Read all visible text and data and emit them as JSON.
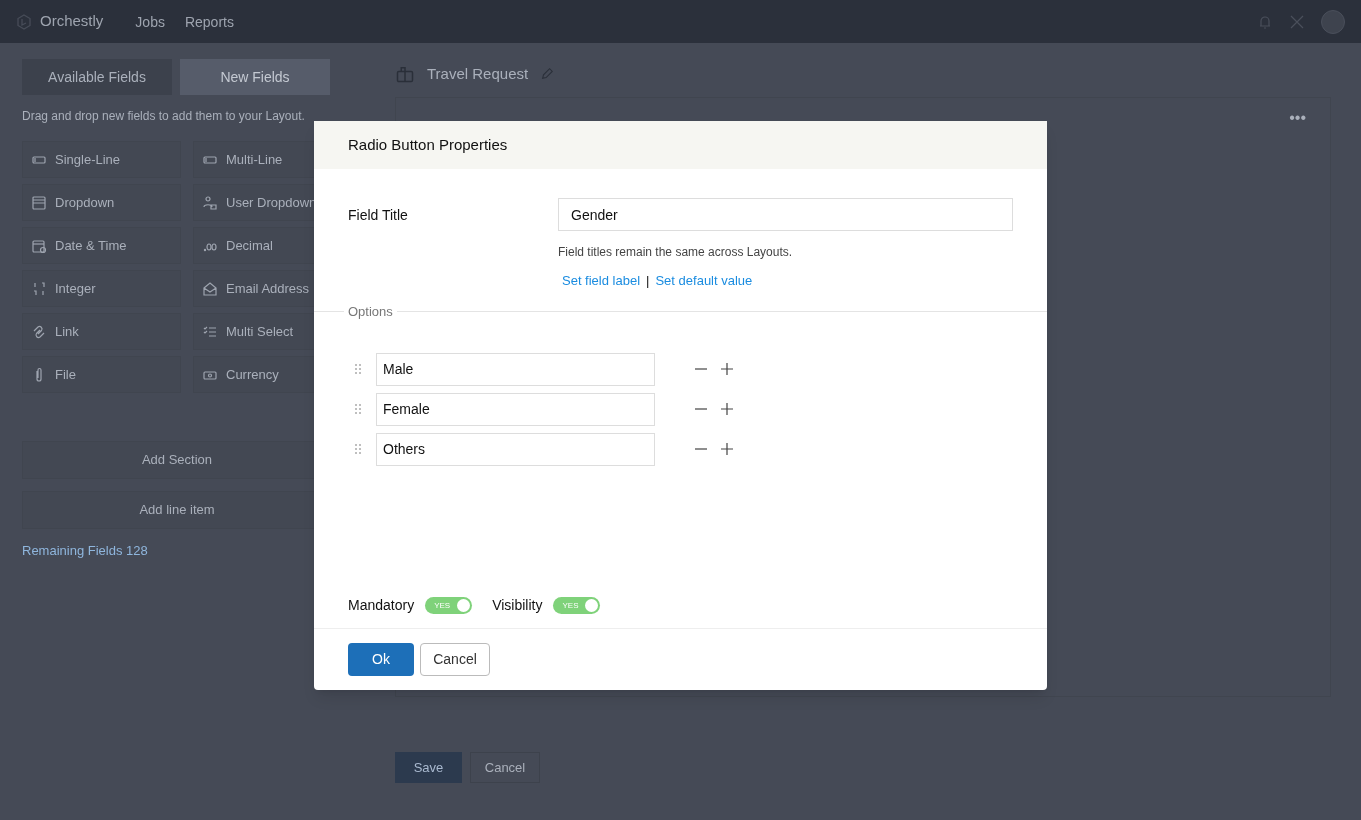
{
  "topbar": {
    "brand": "Orchestly",
    "nav": [
      "Jobs",
      "Reports"
    ]
  },
  "left_panel": {
    "tabs": [
      {
        "label": "Available Fields",
        "selected": false
      },
      {
        "label": "New Fields",
        "selected": true
      }
    ],
    "hint": "Drag and drop new fields to add them to your Layout.",
    "fields": [
      {
        "label": "Single-Line",
        "kind": "single"
      },
      {
        "label": "Multi-Line",
        "kind": "multi"
      },
      {
        "label": "Dropdown",
        "kind": "dropdown"
      },
      {
        "label": "User Dropdown",
        "kind": "user"
      },
      {
        "label": "Date & Time",
        "kind": "date"
      },
      {
        "label": "Decimal",
        "kind": "decimal"
      },
      {
        "label": "Integer",
        "kind": "integer"
      },
      {
        "label": "Email Address",
        "kind": "email"
      },
      {
        "label": "Link",
        "kind": "link"
      },
      {
        "label": "Multi Select",
        "kind": "multiselect"
      },
      {
        "label": "File",
        "kind": "file"
      },
      {
        "label": "Currency",
        "kind": "currency"
      }
    ],
    "add_section": "Add Section",
    "add_line_item": "Add line item",
    "remaining": "Remaining Fields 128"
  },
  "layout": {
    "title": "Travel Request",
    "more": "•••",
    "buttons": [
      "Save",
      "Cancel"
    ]
  },
  "dialog": {
    "title": "Radio Button Properties",
    "field_title_label": "Field Title",
    "field_title_value": "Gender",
    "note": "Field titles remain the same across Layouts.",
    "links": [
      "Set field label",
      "Set default value"
    ],
    "separator": "|",
    "options_legend": "Options",
    "options": [
      {
        "value": "Male"
      },
      {
        "value": "Female"
      },
      {
        "value": "Others"
      }
    ],
    "toggles": [
      {
        "label": "Mandatory",
        "on": true,
        "text": "YES"
      },
      {
        "label": "Visibility",
        "on": true,
        "text": "YES"
      }
    ],
    "ok": "Ok",
    "cancel": "Cancel"
  }
}
